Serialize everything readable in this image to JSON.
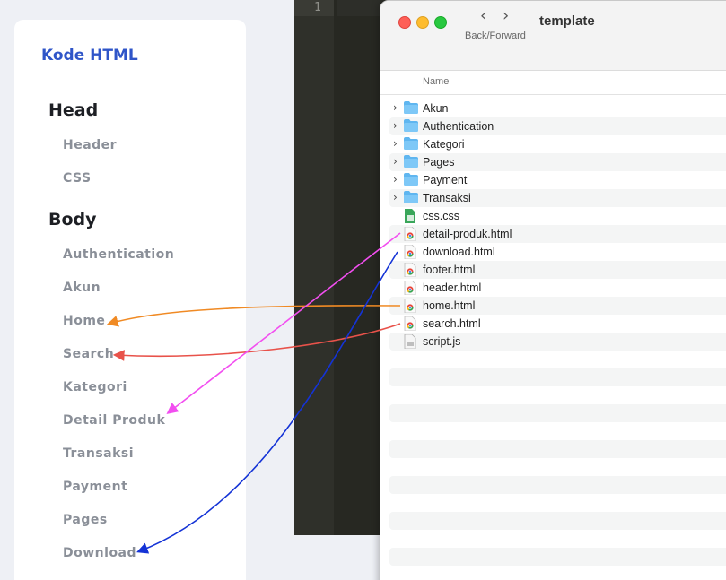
{
  "sidebar": {
    "brand": "Kode HTML",
    "sections": [
      {
        "title": "Head",
        "links": [
          "Header",
          "CSS"
        ]
      },
      {
        "title": "Body",
        "links": [
          "Authentication",
          "Akun",
          "Home",
          "Search",
          "Kategori",
          "Detail Produk",
          "Transaksi",
          "Payment",
          "Pages",
          "Download"
        ]
      }
    ]
  },
  "editor": {
    "line_number": "1"
  },
  "finder": {
    "title": "template",
    "nav_caption": "Back/Forward",
    "column_header": "Name",
    "items": [
      {
        "name": "Akun",
        "type": "folder"
      },
      {
        "name": "Authentication",
        "type": "folder"
      },
      {
        "name": "Kategori",
        "type": "folder"
      },
      {
        "name": "Pages",
        "type": "folder"
      },
      {
        "name": "Payment",
        "type": "folder"
      },
      {
        "name": "Transaksi",
        "type": "folder"
      },
      {
        "name": "css.css",
        "type": "css"
      },
      {
        "name": "detail-produk.html",
        "type": "html"
      },
      {
        "name": "download.html",
        "type": "html"
      },
      {
        "name": "footer.html",
        "type": "html"
      },
      {
        "name": "header.html",
        "type": "html"
      },
      {
        "name": "home.html",
        "type": "html"
      },
      {
        "name": "search.html",
        "type": "html"
      },
      {
        "name": "script.js",
        "type": "js"
      }
    ]
  },
  "colors": {
    "brand": "#2f55c8",
    "arrow_home": "#f08a24",
    "arrow_search": "#e8524a",
    "arrow_detail": "#f24ef0",
    "arrow_download": "#1433d6"
  }
}
